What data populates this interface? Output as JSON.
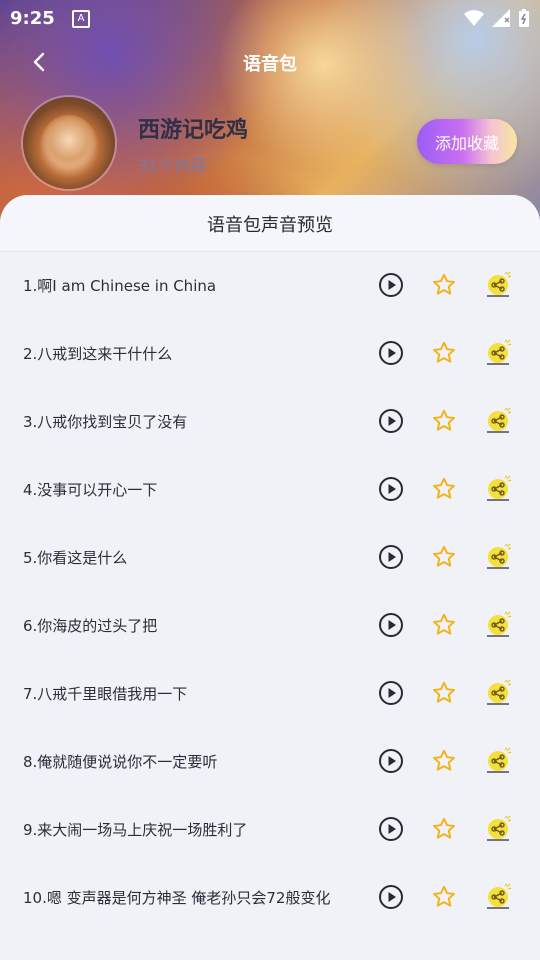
{
  "status": {
    "time": "9:25",
    "left_icon": "A"
  },
  "header": {
    "title": "语音包"
  },
  "pack": {
    "name": "西游记吃鸡",
    "count": "31个内容",
    "fav_button": "添加收藏"
  },
  "preview": {
    "title": "语音包声音预览"
  },
  "items": [
    {
      "label": "1.啊I am Chinese in China"
    },
    {
      "label": "2.八戒到这来干什什么"
    },
    {
      "label": "3.八戒你找到宝贝了没有"
    },
    {
      "label": "4.没事可以开心一下"
    },
    {
      "label": "5.你看这是什么"
    },
    {
      "label": "6.你海皮的过头了把"
    },
    {
      "label": "7.八戒千里眼借我用一下"
    },
    {
      "label": "8.俺就随便说说你不一定要听"
    },
    {
      "label": "9.来大闹一场马上庆祝一场胜利了"
    },
    {
      "label": "10.嗯 变声器是何方神圣 俺老孙只会72般变化"
    }
  ]
}
